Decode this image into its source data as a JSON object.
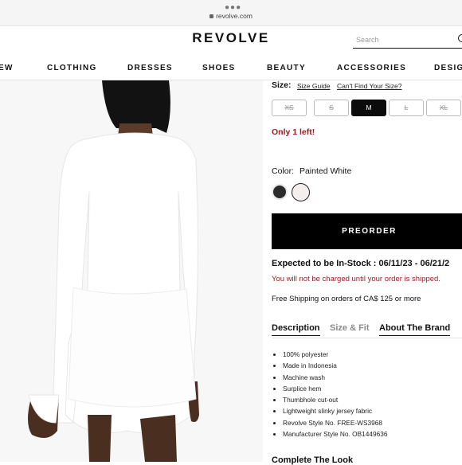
{
  "browser": {
    "url": "revolve.com"
  },
  "header": {
    "logo": "REVOLVE",
    "search_placeholder": "Search"
  },
  "nav": [
    "EW",
    "CLOTHING",
    "DRESSES",
    "SHOES",
    "BEAUTY",
    "ACCESSORIES",
    "DESIG"
  ],
  "size": {
    "label": "Size:",
    "guide_link": "Size Guide",
    "cant_find_link": "Can't Find Your Size?",
    "options": [
      "XS",
      "S",
      "M",
      "L",
      "XL"
    ],
    "selected": "M"
  },
  "stock_note": "Only 1 left!",
  "color": {
    "label": "Color:",
    "value": "Painted White",
    "swatches": [
      "#2b2b2b",
      "#f4eeee"
    ]
  },
  "preorder_label": "PREORDER",
  "expected": "Expected to be In-Stock : 06/11/23 - 06/21/2",
  "not_charged": "You will not be charged until your order is shipped.",
  "shipping": "Free Shipping on orders of CA$ 125 or more",
  "tabs": [
    "Description",
    "Size & Fit",
    "About The Brand"
  ],
  "details": [
    "100% polyester",
    "Made in Indonesia",
    "Machine wash",
    "Surplice hem",
    "Thumbhole cut-out",
    "Lightweight slinky jersey fabric",
    "Revolve Style No. FREE-WS3968",
    "Manufacturer Style No. OB1449636"
  ],
  "complete_the_look": "Complete The Look",
  "colors": {
    "accent_red": "#9b1c23",
    "button_black": "#000000"
  }
}
